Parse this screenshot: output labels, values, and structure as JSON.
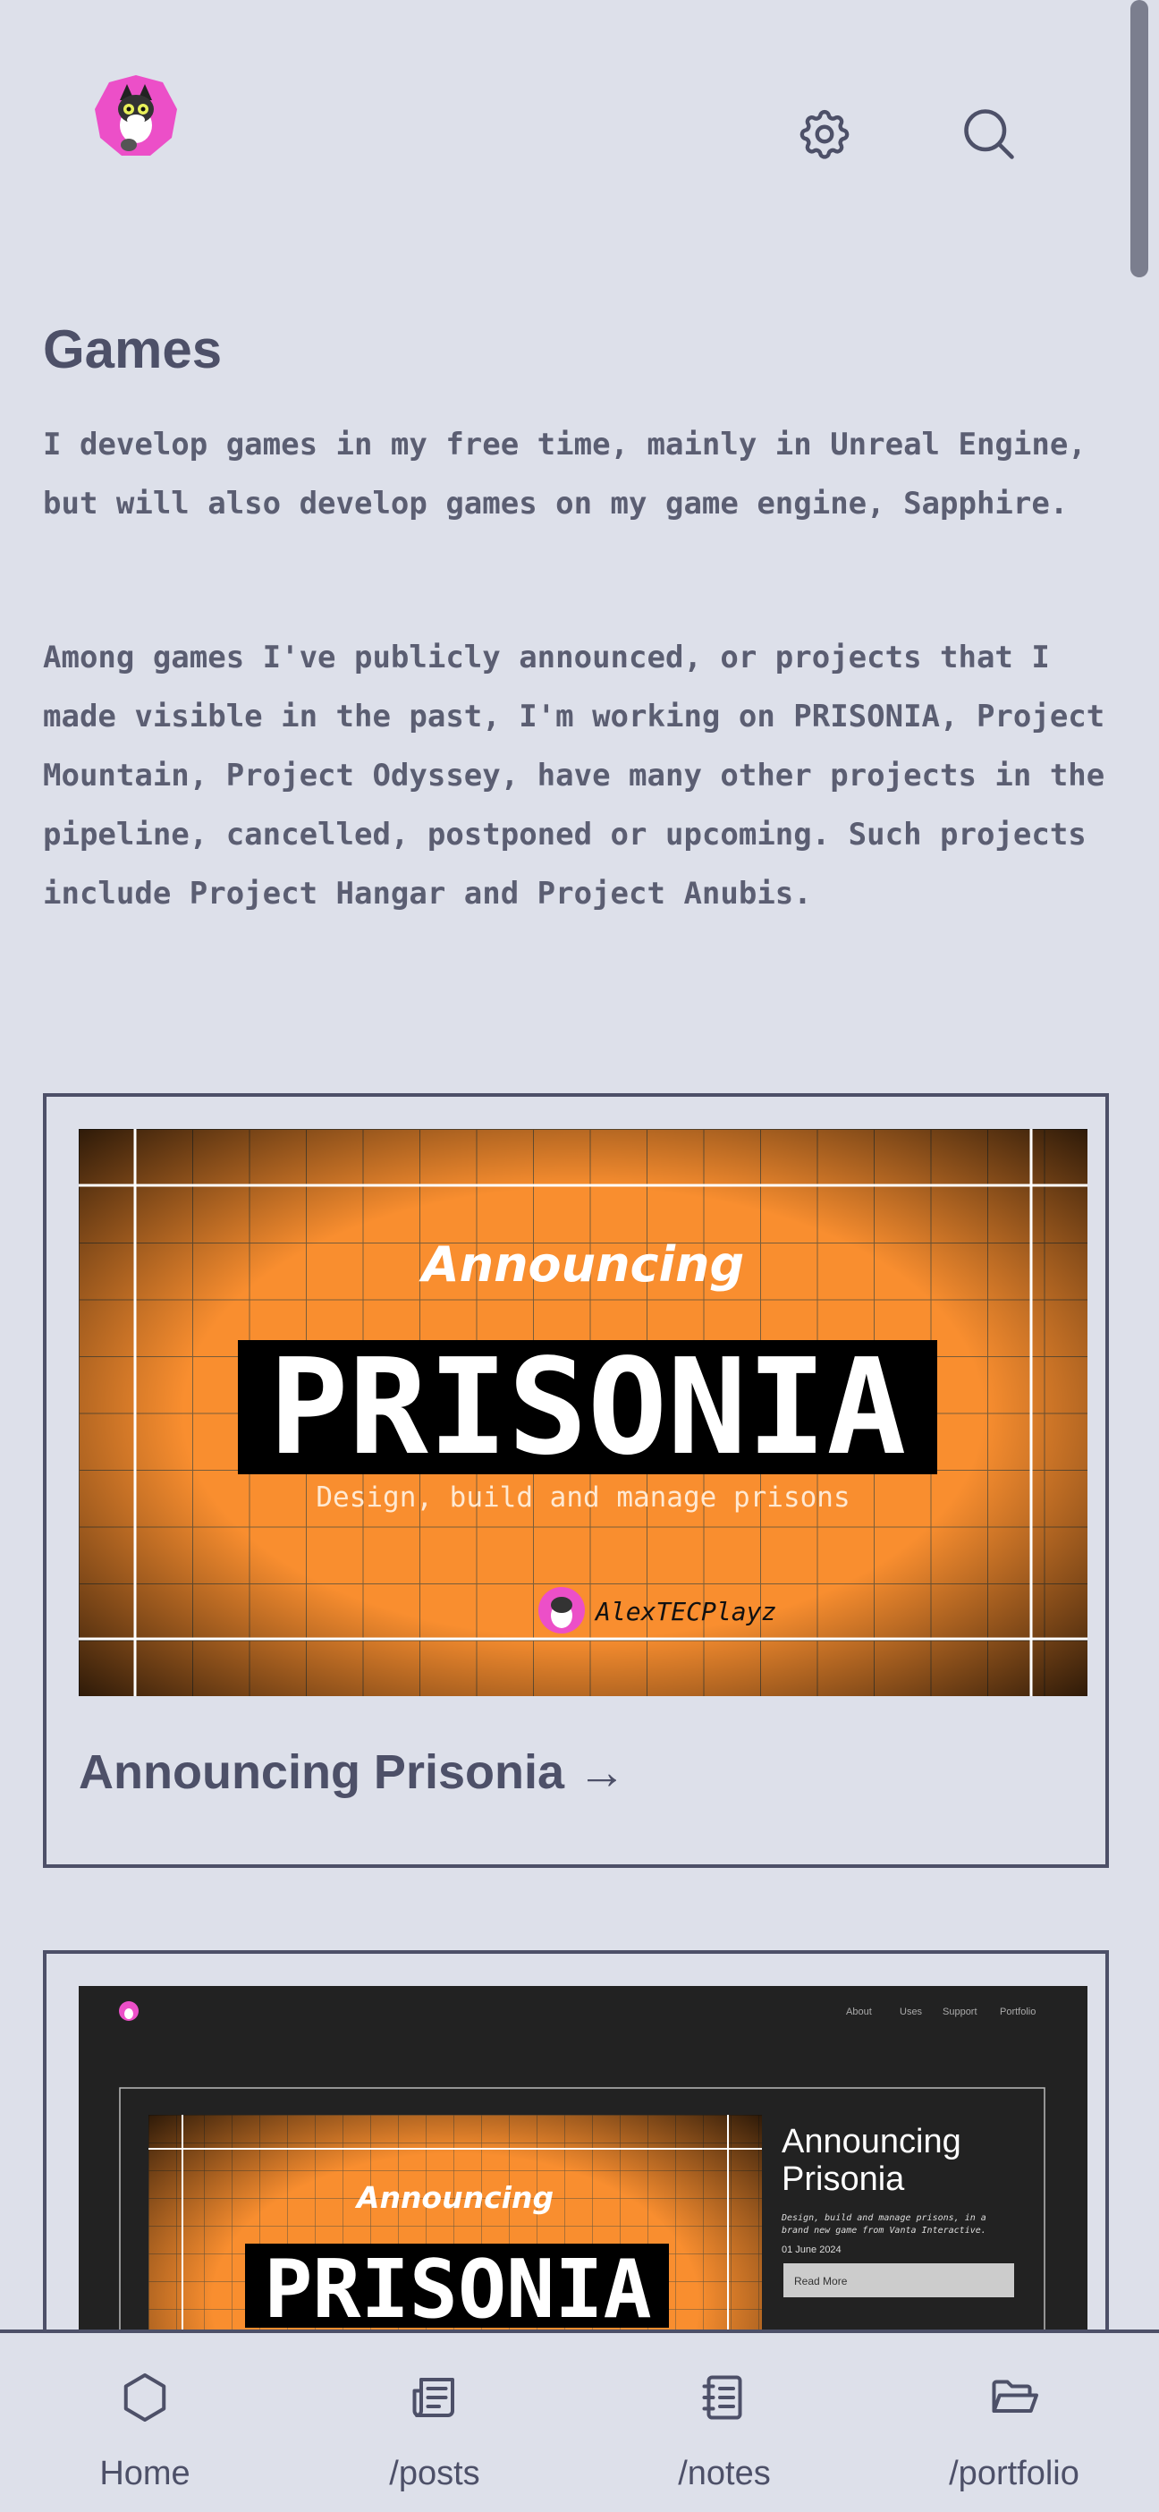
{
  "header": {
    "logo_icon": "fox-avatar-icon",
    "settings_icon": "gear-icon",
    "search_icon": "search-icon"
  },
  "page": {
    "title": "Games",
    "paragraph_1": "I develop games in my free time, mainly in Unreal Engine, but will also develop games on my game engine, Sapphire.",
    "paragraph_2": "Among games I've publicly announced, or projects that I made visible in the past, I'm working on PRISONIA, Project Mountain, Project Odyssey, have many other projects in the pipeline, cancelled, postponed or upcoming. Such projects include Project Hangar and Project Anubis."
  },
  "cards": [
    {
      "banner": {
        "kicker": "Announcing",
        "headline": "PRISONIA",
        "tagline": "Design, build and manage prisons",
        "author": "AlexTECPlayz"
      },
      "title": "Announcing Prisonia →"
    },
    {
      "site_nav": [
        "About",
        "Uses",
        "Support",
        "Portfolio"
      ],
      "banner_kicker": "Announcing",
      "banner_headline": "PRISONIA",
      "post_title": "Announcing Prisonia",
      "post_desc": "Design, build and manage prisons, in a brand new game from Vanta Interactive.",
      "post_date": "01 June 2024",
      "read_more": "Read More"
    }
  ],
  "bottom_nav": [
    {
      "label": "Home",
      "icon": "hexagon-icon"
    },
    {
      "label": "/posts",
      "icon": "newspaper-icon"
    },
    {
      "label": "/notes",
      "icon": "notebook-icon"
    },
    {
      "label": "/portfolio",
      "icon": "folder-open-icon"
    }
  ],
  "colors": {
    "background": "#dde0ea",
    "text": "#4d5068",
    "accent_orange": "#f98e2f",
    "avatar_pink": "#ec4fc8"
  }
}
